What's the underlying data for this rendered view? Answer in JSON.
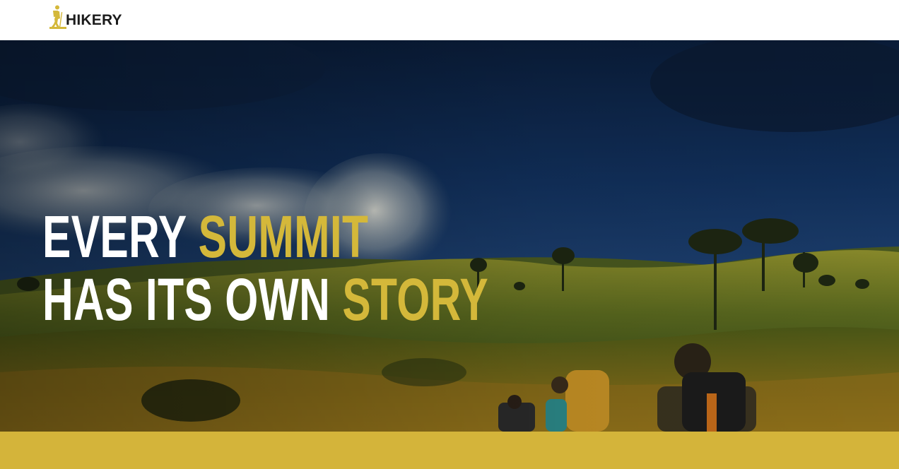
{
  "brand": {
    "name": "HIKERY",
    "logo_icon": "hiker-icon",
    "accent_color": "#d4b83a"
  },
  "hero": {
    "line1_white": "EVERY",
    "line1_accent": "SUMMIT",
    "line2_white": "HAS ITS OWN",
    "line2_accent": "STORY",
    "background": "hikers-on-grassy-hill-image"
  },
  "colors": {
    "accent": "#d4b83a",
    "band": "#d4b43a",
    "header_bg": "#ffffff",
    "headline_text": "#ffffff"
  }
}
